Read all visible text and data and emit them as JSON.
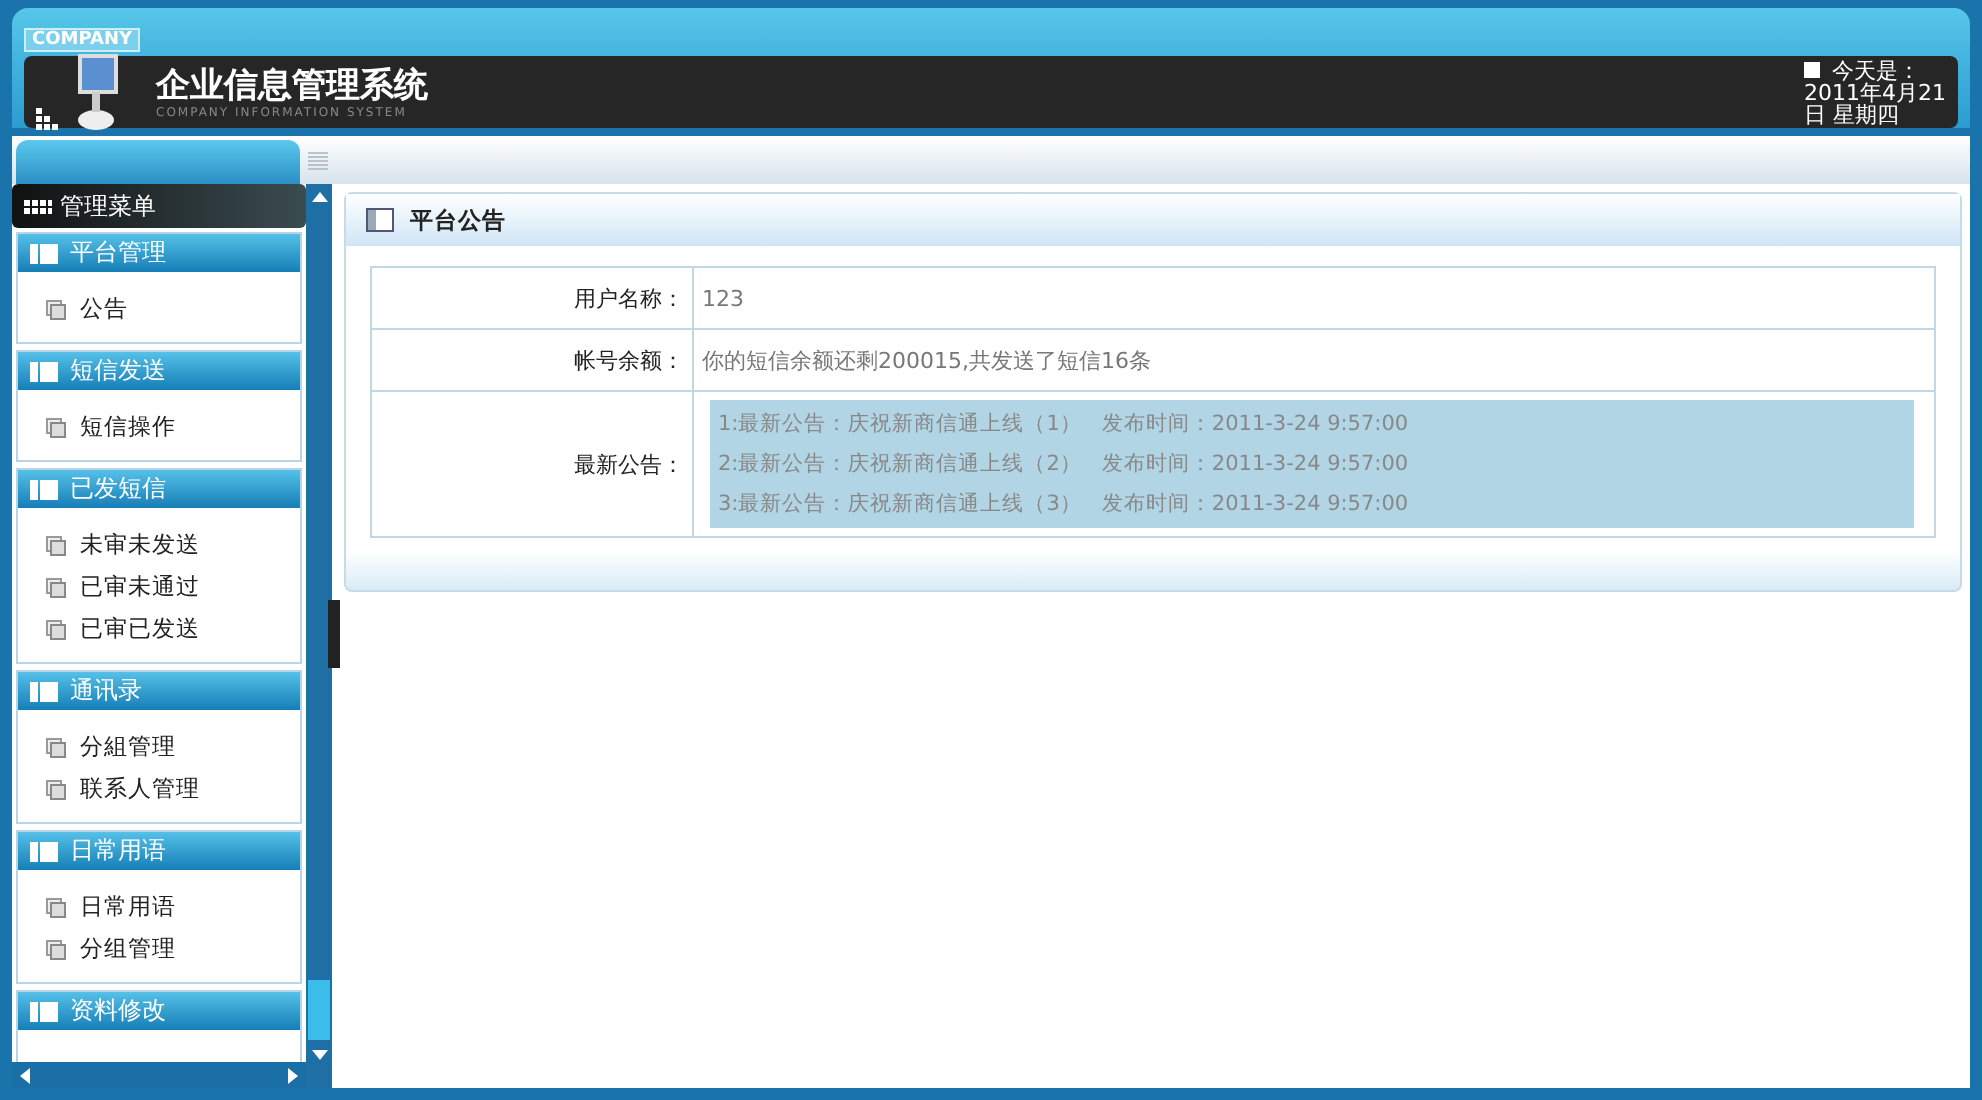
{
  "header": {
    "company_badge": "COMPANY",
    "title": "企业信息管理系统",
    "subtitle": "COMPANY INFORMATION SYSTEM",
    "date_label": "今天是：",
    "date_lines": [
      "2011年4月21",
      "日 星期四"
    ]
  },
  "sidebar": {
    "title": "管理菜单",
    "sections": [
      {
        "title": "平台管理",
        "items": [
          "公告"
        ]
      },
      {
        "title": "短信发送",
        "items": [
          "短信操作"
        ]
      },
      {
        "title": "已发短信",
        "items": [
          "未审未发送",
          "已审未通过",
          "已审已发送"
        ]
      },
      {
        "title": "通讯录",
        "items": [
          "分組管理",
          "联系人管理"
        ]
      },
      {
        "title": "日常用语",
        "items": [
          "日常用语",
          "分组管理"
        ]
      },
      {
        "title": "资料修改"
      }
    ]
  },
  "panel": {
    "title": "平台公告",
    "rows": [
      {
        "kind": "text",
        "label": "用户名称：",
        "value": "123"
      },
      {
        "kind": "text",
        "label": "帐号余额：",
        "value": "你的短信余额还剩200015,共发送了短信16条"
      },
      {
        "kind": "notices",
        "label": "最新公告：",
        "notices": [
          {
            "text": "1:最新公告：庆祝新商信通上线（1）",
            "time": "发布时间：2011-3-24 9:57:00"
          },
          {
            "text": "2:最新公告：庆祝新商信通上线（2）",
            "time": "发布时间：2011-3-24 9:57:00"
          },
          {
            "text": "3:最新公告：庆祝新商信通上线（3）",
            "time": "发布时间：2011-3-24 9:57:00"
          }
        ]
      }
    ]
  }
}
